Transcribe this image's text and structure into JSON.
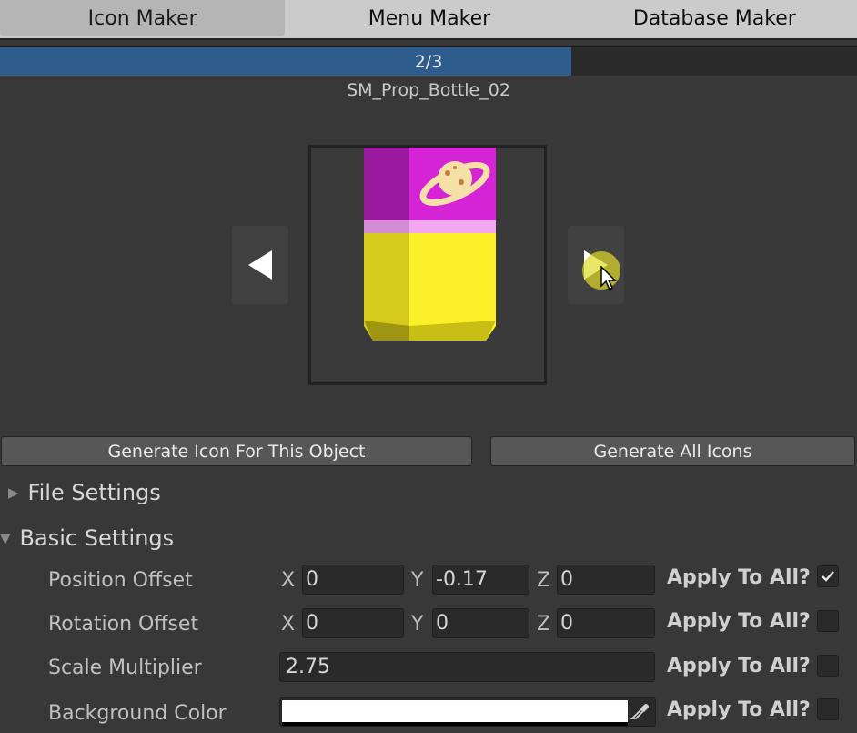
{
  "tabs": {
    "icon_maker": "Icon Maker",
    "menu_maker": "Menu Maker",
    "database_maker": "Database Maker"
  },
  "progress": {
    "text": "2/3",
    "fraction": 0.6667
  },
  "asset": {
    "name": "SM_Prop_Bottle_02"
  },
  "buttons": {
    "generate_this": "Generate Icon For This Object",
    "generate_all": "Generate All Icons"
  },
  "sections": {
    "file_settings": "File Settings",
    "basic_settings": "Basic Settings"
  },
  "props": {
    "position": {
      "label": "Position Offset",
      "x": "0",
      "y": "-0.17",
      "z": "0",
      "apply_all": true
    },
    "rotation": {
      "label": "Rotation Offset",
      "x": "0",
      "y": "0",
      "z": "0",
      "apply_all": false
    },
    "scale": {
      "label": "Scale Multiplier",
      "value": "2.75",
      "apply_all": false
    },
    "background": {
      "label": "Background Color",
      "color": "#ffffff",
      "apply_all": false
    }
  },
  "axis": {
    "x": "X",
    "y": "Y",
    "z": "Z"
  },
  "apply_label": "Apply To All?",
  "icons": {
    "prev": "triangle-left-icon",
    "next": "triangle-right-icon",
    "cursor": "mouse-pointer-icon",
    "eyedropper": "eyedropper-icon",
    "foldout_collapsed": "triangle-right-small-icon",
    "foldout_expanded": "triangle-down-small-icon",
    "check": "checkmark-icon"
  },
  "colors": {
    "accent": "#2e5c8c",
    "bottle_magenta": "#c51fc8",
    "bottle_yellow": "#f8f022"
  }
}
